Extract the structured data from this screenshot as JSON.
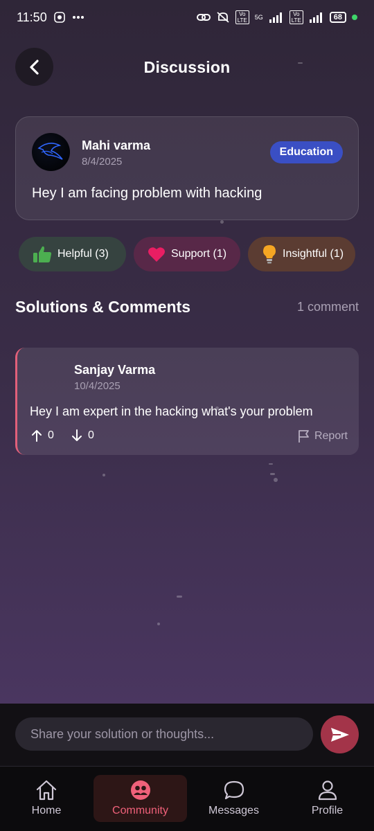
{
  "status_bar": {
    "time": "11:50",
    "notif_icons": [
      "shield-app-icon",
      "more-dots-icon"
    ],
    "battery": "68",
    "network_1": "5G",
    "network_label": "Vo LTE"
  },
  "header": {
    "title": "Discussion"
  },
  "post": {
    "author": "Mahi varma",
    "date": "8/4/2025",
    "tag": "Education",
    "tag_color": "#3a4fc4",
    "text": "Hey I am facing problem with hacking"
  },
  "reactions": [
    {
      "label": "Helpful (3)",
      "icon": "thumbs-up-icon",
      "color": "#4caf50"
    },
    {
      "label": "Support (1)",
      "icon": "heart-icon",
      "color": "#e91e63"
    },
    {
      "label": "Insightful (1)",
      "icon": "lightbulb-icon",
      "color": "#f5a623"
    }
  ],
  "comments_section": {
    "title": "Solutions & Comments",
    "count": "1 comment"
  },
  "comments": [
    {
      "author": "Sanjay Varma",
      "date": "10/4/2025",
      "text": "Hey I am expert in the hacking what's your problem",
      "upvotes": "0",
      "downvotes": "0",
      "report_label": "Report",
      "accent_color": "#e2607a"
    }
  ],
  "composer": {
    "placeholder": "Share your solution or thoughts..."
  },
  "bottom_nav": {
    "home": "Home",
    "community": "Community",
    "messages": "Messages",
    "profile": "Profile",
    "active": "Community",
    "active_color": "#f0617a"
  }
}
